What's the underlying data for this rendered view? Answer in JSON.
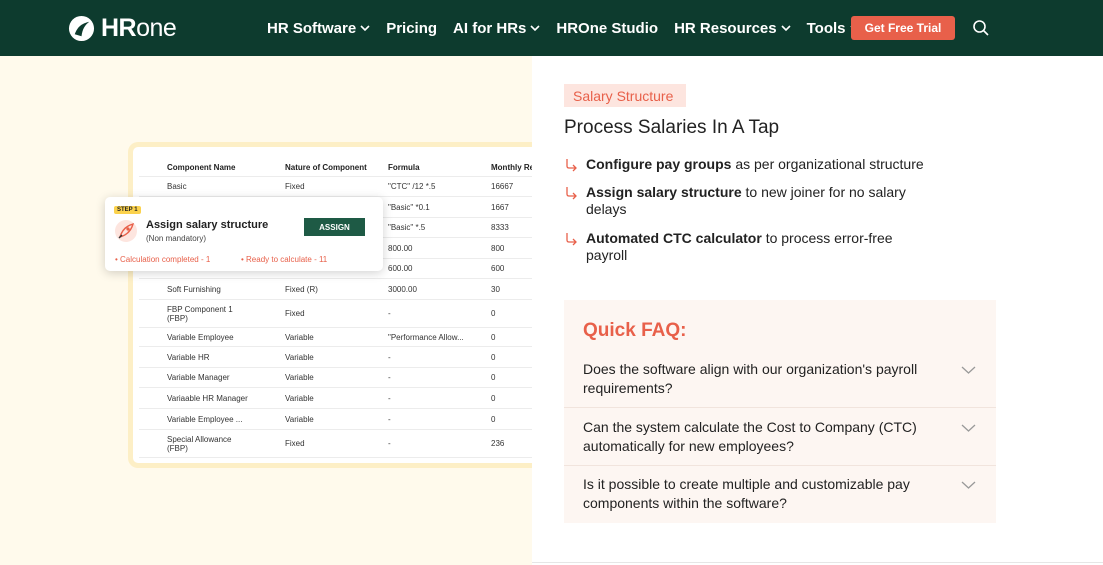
{
  "nav": {
    "logo_bold": "HR",
    "logo_light": "one",
    "items": [
      {
        "label": "HR Software",
        "dropdown": true
      },
      {
        "label": "Pricing",
        "dropdown": false
      },
      {
        "label": "AI for HRs",
        "dropdown": true
      },
      {
        "label": "HROne Studio",
        "dropdown": false
      },
      {
        "label": "HR Resources",
        "dropdown": true
      },
      {
        "label": "Tools",
        "dropdown": true
      }
    ],
    "cta": "Get Free Trial",
    "search_icon": "search-icon"
  },
  "table": {
    "headers": [
      "Component Name",
      "Nature of Component",
      "Formula",
      "Monthly Re"
    ],
    "rows": [
      [
        "Basic",
        "Fixed",
        "\"CTC\" /12 *.5",
        "16667"
      ],
      [
        "",
        "",
        "\"Basic\" *0.1",
        "1667"
      ],
      [
        "",
        "",
        "\"Basic\" *.5",
        "8333"
      ],
      [
        "",
        "",
        "800.00",
        "800"
      ],
      [
        "",
        "",
        "600.00",
        "600"
      ],
      [
        "Soft Furnishing",
        "Fixed (R)",
        "3000.00",
        "30"
      ],
      [
        "FBP Component 1\n(FBP)",
        "Fixed",
        "-",
        "0"
      ],
      [
        "Variable Employee",
        "Variable",
        "\"Performance Allow...",
        "0"
      ],
      [
        "Variable HR",
        "Variable",
        "-",
        "0"
      ],
      [
        "Variable Manager",
        "Variable",
        "-",
        "0"
      ],
      [
        "Variaable HR Manager",
        "Variable",
        "-",
        "0"
      ],
      [
        "Variable Employee ...",
        "Variable",
        "-",
        "0"
      ],
      [
        "Special Allowance\n(FBP)",
        "Fixed",
        "-",
        "236"
      ]
    ]
  },
  "overlay": {
    "step": "STEP 1",
    "title": "Assign salary structure",
    "subtitle": "(Non mandatory)",
    "button": "ASSIGN",
    "calc": "• Calculation completed - 1",
    "ready": "• Ready to calculate - 11"
  },
  "content": {
    "tag": "Salary Structure",
    "heading": "Process Salaries In A Tap",
    "features": [
      {
        "bold": "Configure pay groups",
        "rest": " as per organizational structure"
      },
      {
        "bold": "Assign salary structure",
        "rest": " to new joiner for no salary delays"
      },
      {
        "bold": "Automated CTC calculator",
        "rest": " to process error-free payroll"
      }
    ]
  },
  "faq": {
    "title": "Quick FAQ:",
    "items": [
      "Does the software align with our organization's payroll requirements?",
      "Can the system calculate the Cost to Company (CTC) automatically for new employees?",
      "Is it possible to create multiple and customizable pay components within the software?"
    ]
  },
  "colors": {
    "nav_bg": "#0d3b2e",
    "accent": "#e8604a",
    "left_bg": "#fffaec",
    "faq_bg": "#fdf6f2"
  }
}
